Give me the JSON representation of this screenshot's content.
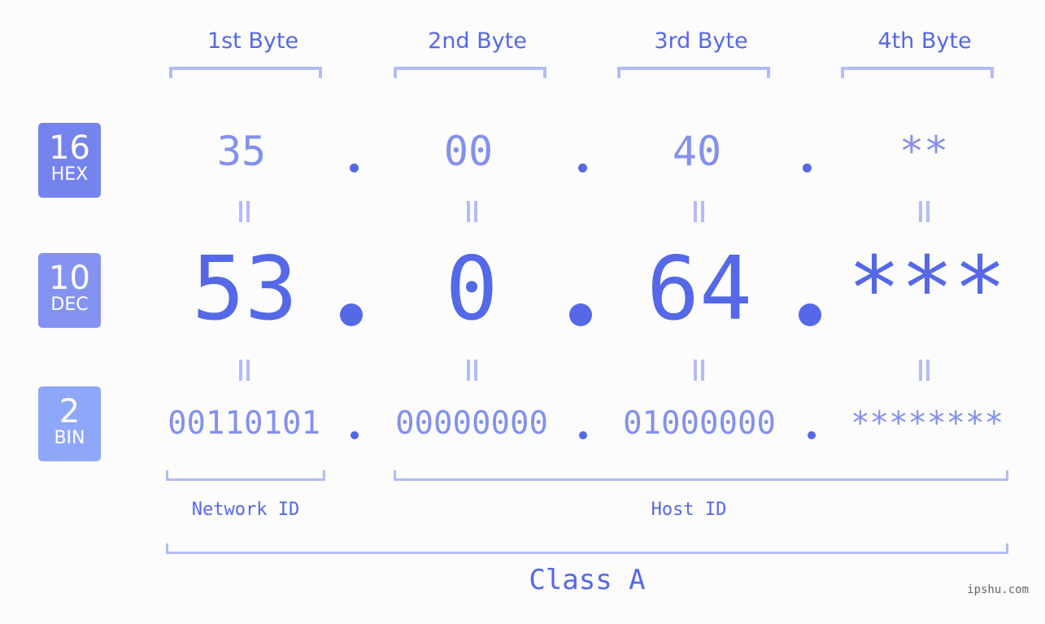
{
  "headers": [
    "1st Byte",
    "2nd Byte",
    "3rd Byte",
    "4th Byte"
  ],
  "badges": {
    "hex": {
      "number": "16",
      "label": "HEX",
      "color": "#7583ed"
    },
    "dec": {
      "number": "10",
      "label": "DEC",
      "color": "#8492f2"
    },
    "bin": {
      "number": "2",
      "label": "BIN",
      "color": "#8fa7f8"
    }
  },
  "hex_octets": [
    "35",
    "00",
    "40",
    "**"
  ],
  "dec_octets": [
    "53",
    "0",
    "64",
    "***"
  ],
  "bin_octets": [
    "00110101",
    "00000000",
    "01000000",
    "********"
  ],
  "network_label": "Network ID",
  "host_label": "Host ID",
  "class_label": "Class A",
  "watermark": "ipshu.com",
  "colors": {
    "primary": "#5468e8",
    "light": "#8390ee",
    "bracket": "#b3bcf6",
    "background": "#fbfcfb"
  }
}
